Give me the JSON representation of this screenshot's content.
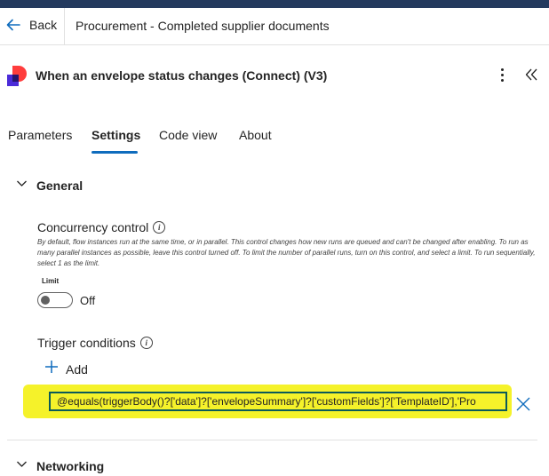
{
  "header": {
    "back_label": "Back",
    "breadcrumb": "Procurement - Completed supplier documents"
  },
  "panel": {
    "title": "When an envelope status changes (Connect) (V3)",
    "logo_color": "#ff3d3d",
    "logo_accent": "#4b2bd9"
  },
  "tabs": [
    {
      "label": "Parameters",
      "active": false
    },
    {
      "label": "Settings",
      "active": true
    },
    {
      "label": "Code view",
      "active": false
    },
    {
      "label": "About",
      "active": false
    }
  ],
  "sections": {
    "general": {
      "label": "General",
      "concurrency": {
        "title": "Concurrency control",
        "description": "By default, flow instances run at the same time, or in parallel. This control changes how new runs are queued and can't be changed after enabling. To run as many parallel instances as possible, leave this control turned off. To limit the number of parallel runs, turn on this control, and select a limit. To run sequentially, select 1 as the limit.",
        "limit_label": "Limit",
        "toggle_state": "Off"
      },
      "trigger_conditions": {
        "title": "Trigger conditions",
        "add_label": "Add",
        "condition_value": "@equals(triggerBody()?['data']?['envelopeSummary']?['customFields']?['TemplateID'],'Pro"
      }
    },
    "networking": {
      "label": "Networking"
    }
  },
  "colors": {
    "accent": "#0f6cbd",
    "highlight": "#f5f22a",
    "top_bar": "#243a5e"
  }
}
